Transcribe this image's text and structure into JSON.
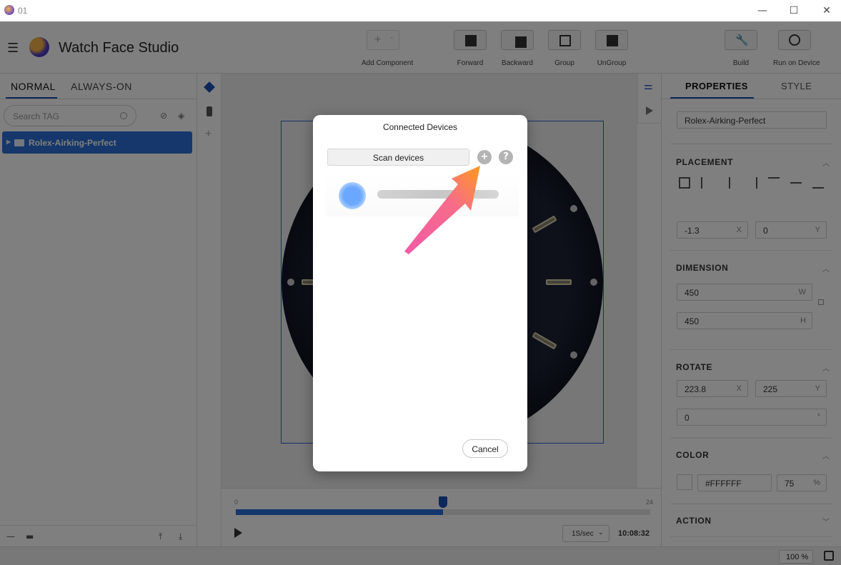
{
  "window": {
    "title": "01",
    "controls": {
      "minimize": "—",
      "maximize": "☐",
      "close": "✕"
    }
  },
  "app": {
    "name": "Watch Face Studio"
  },
  "toolbar": {
    "add_component": "Add Component",
    "forward": "Forward",
    "backward": "Backward",
    "group": "Group",
    "ungroup": "UnGroup",
    "build": "Build",
    "run_on_device": "Run on Device"
  },
  "layers": {
    "tabs": [
      "NORMAL",
      "ALWAYS-ON"
    ],
    "search_placeholder": "Search TAG",
    "items": [
      {
        "label": "Rolex-Airking-Perfect"
      }
    ]
  },
  "timeline": {
    "ticks": [
      "0",
      "12",
      "24"
    ],
    "progress_fraction": 0.5,
    "speed": "1S/sec",
    "time": "10:08:32"
  },
  "properties": {
    "tabs": [
      "PROPERTIES",
      "STYLE"
    ],
    "name": "Rolex-Airking-Perfect",
    "placement": {
      "title": "PLACEMENT",
      "x": "-1.3",
      "x_label": "X",
      "y": "0",
      "y_label": "Y"
    },
    "dimension": {
      "title": "DIMENSION",
      "w": "450",
      "w_label": "W",
      "h": "450",
      "h_label": "H"
    },
    "rotate": {
      "title": "ROTATE",
      "x": "223.8",
      "x_label": "X",
      "y": "225",
      "y_label": "Y",
      "angle": "0",
      "angle_unit": "°"
    },
    "color": {
      "title": "COLOR",
      "hex": "#FFFFFF",
      "opacity": "75",
      "opacity_unit": "%"
    },
    "action": {
      "title": "ACTION"
    }
  },
  "statusbar": {
    "zoom": "100 %"
  },
  "modal": {
    "title": "Connected Devices",
    "scan_button": "Scan devices",
    "add_button": "+",
    "help_button": "?",
    "cancel_button": "Cancel"
  },
  "colors": {
    "accent": "#2b6fd6",
    "arrow": "#f25aa6",
    "arrow_tip": "#ff9a1f"
  }
}
